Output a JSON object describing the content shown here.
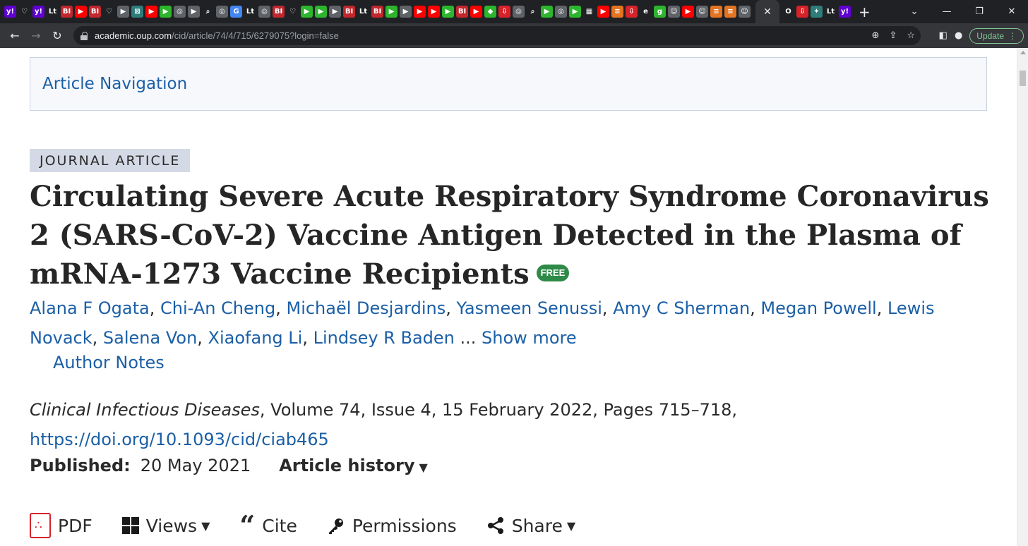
{
  "browser": {
    "active_tab_close": "✕",
    "new_tab": "+",
    "window": {
      "minimize": "—",
      "restore": "❐",
      "close": "✕"
    },
    "address": {
      "host": "academic.oup.com",
      "path": "/cid/article/74/4/715/6279075?login=false"
    },
    "update_label": "Update",
    "favicons": [
      {
        "g": "y!",
        "c": "#6001d2"
      },
      {
        "g": "♡",
        "c": "#202124"
      },
      {
        "g": "y!",
        "c": "#6001d2"
      },
      {
        "g": "Lt",
        "c": "#202124"
      },
      {
        "g": "BI",
        "c": "#c1272d"
      },
      {
        "g": "▶",
        "c": "#ff0000"
      },
      {
        "g": "BI",
        "c": "#c1272d"
      },
      {
        "g": "♡",
        "c": "#202124"
      },
      {
        "g": "▶",
        "c": "#5f6368"
      },
      {
        "g": "⊠",
        "c": "#2f7d7a"
      },
      {
        "g": "▶",
        "c": "#ff0000"
      },
      {
        "g": "▶",
        "c": "#2db52d"
      },
      {
        "g": "◎",
        "c": "#5f6368"
      },
      {
        "g": "▶",
        "c": "#5f6368"
      },
      {
        "g": "⌕",
        "c": "#202124"
      },
      {
        "g": "◎",
        "c": "#5f6368"
      },
      {
        "g": "G",
        "c": "#4285f4"
      },
      {
        "g": "Lt",
        "c": "#202124"
      },
      {
        "g": "◎",
        "c": "#5f6368"
      },
      {
        "g": "BI",
        "c": "#c1272d"
      },
      {
        "g": "♡",
        "c": "#202124"
      },
      {
        "g": "▶",
        "c": "#2db52d"
      },
      {
        "g": "▶",
        "c": "#2db52d"
      },
      {
        "g": "▶",
        "c": "#5f6368"
      },
      {
        "g": "BI",
        "c": "#c1272d"
      },
      {
        "g": "Lt",
        "c": "#202124"
      },
      {
        "g": "BI",
        "c": "#c1272d"
      },
      {
        "g": "▶",
        "c": "#2db52d"
      },
      {
        "g": "▶",
        "c": "#5f6368"
      },
      {
        "g": "▶",
        "c": "#ff0000"
      },
      {
        "g": "▶",
        "c": "#ff0000"
      },
      {
        "g": "▶",
        "c": "#2db52d"
      },
      {
        "g": "BI",
        "c": "#c1272d"
      },
      {
        "g": "▶",
        "c": "#ff0000"
      },
      {
        "g": "◆",
        "c": "#2db52d"
      },
      {
        "g": "⇩",
        "c": "#d8222a"
      },
      {
        "g": "◎",
        "c": "#5f6368"
      },
      {
        "g": "⌕",
        "c": "#202124"
      },
      {
        "g": "▶",
        "c": "#2db52d"
      },
      {
        "g": "◎",
        "c": "#5f6368"
      },
      {
        "g": "▶",
        "c": "#2db52d"
      },
      {
        "g": "▦",
        "c": "#202124"
      },
      {
        "g": "▶",
        "c": "#ff0000"
      },
      {
        "g": "≡",
        "c": "#e37422"
      },
      {
        "g": "⇩",
        "c": "#d8222a"
      },
      {
        "g": "e",
        "c": "#202124"
      },
      {
        "g": "g",
        "c": "#2db52d"
      },
      {
        "g": "☺",
        "c": "#5f6368"
      },
      {
        "g": "▶",
        "c": "#ff0000"
      },
      {
        "g": "☺",
        "c": "#5f6368"
      },
      {
        "g": "≡",
        "c": "#e37422"
      },
      {
        "g": "≡",
        "c": "#e37422"
      },
      {
        "g": "☺",
        "c": "#5f6368"
      }
    ],
    "favicons_after": [
      {
        "g": "O",
        "c": "#202124"
      },
      {
        "g": "⇩",
        "c": "#d8222a"
      },
      {
        "g": "✦",
        "c": "#2f7d7a"
      },
      {
        "g": "Lt",
        "c": "#202124"
      },
      {
        "g": "y!",
        "c": "#6001d2"
      }
    ]
  },
  "page": {
    "article_nav": "Article Navigation",
    "badge": "JOURNAL ARTICLE",
    "title": "Circulating Severe Acute Respiratory Syndrome Coronavirus 2 (SARS-CoV-2) Vaccine Antigen Detected in the Plasma of mRNA-1273 Vaccine Recipients",
    "free_badge": "FREE",
    "authors": [
      "Alana F Ogata",
      "Chi-An Cheng",
      "Michaël Desjardins",
      "Yasmeen Senussi",
      "Amy C Sherman",
      "Megan Powell",
      "Lewis Novack",
      "Salena Von",
      "Xiaofang Li",
      "Lindsey R Baden"
    ],
    "ellipsis": "...",
    "show_more": "Show more",
    "author_notes": "Author Notes",
    "journal": "Clinical Infectious Diseases",
    "citation_rest": ", Volume 74, Issue 4, 15 February 2022, Pages 715–718,",
    "doi": "https://doi.org/10.1093/cid/ciab465",
    "published_label": "Published:",
    "published_date": "20 May 2021",
    "article_history": "Article history",
    "caret": "▼",
    "actions": {
      "pdf": "PDF",
      "views": "Views",
      "cite": "Cite",
      "permissions": "Permissions",
      "share": "Share"
    }
  }
}
